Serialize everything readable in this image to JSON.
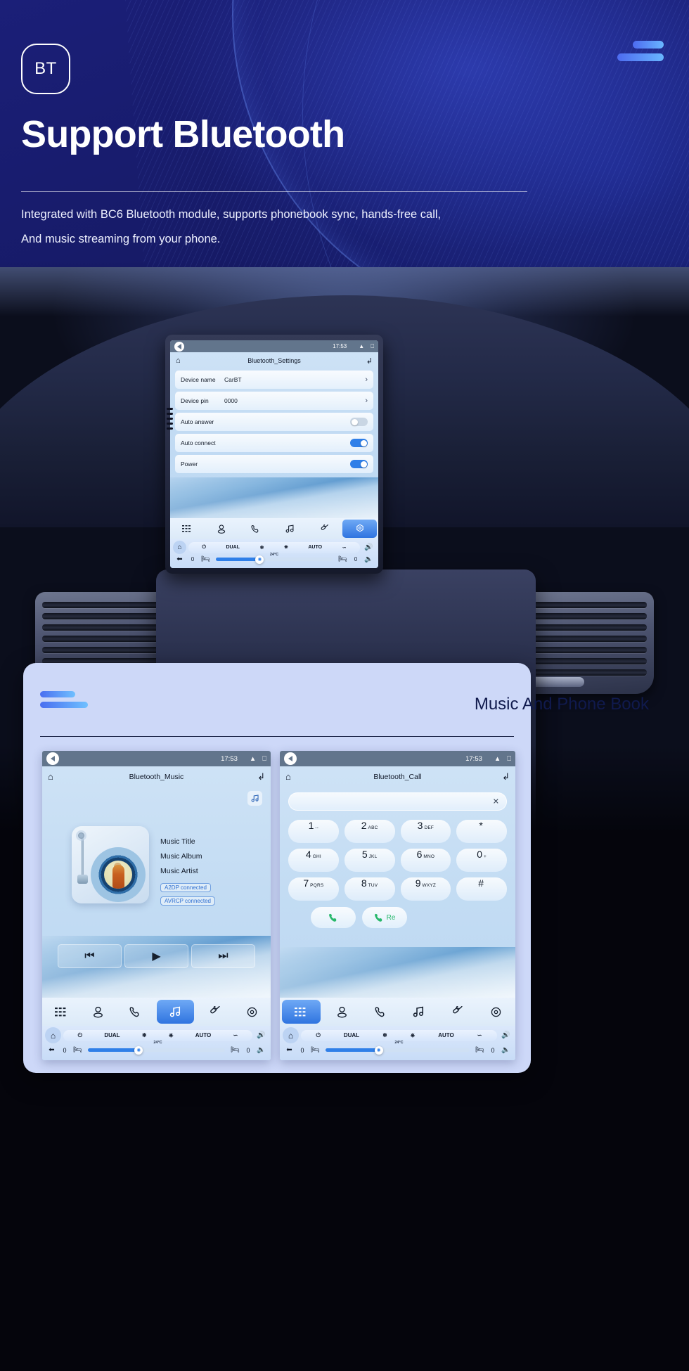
{
  "hero": {
    "badge": "BT",
    "title": "Support Bluetooth",
    "subtitle_line1": "Integrated with BC6 Bluetooth module, supports phonebook sync, hands-free call,",
    "subtitle_line2": "And music streaming from your phone.",
    "accent_start": "#4d6bf0",
    "accent_end": "#69b6ff",
    "bg_color": "#181c6e"
  },
  "settings_screen": {
    "status": {
      "time": "17:53",
      "speaker_icon": "speaker-icon",
      "chevron_icon": "chevrons-up-icon",
      "recent_icon": "recents-icon"
    },
    "home_icon": "home-icon",
    "title": "Bluetooth_Settings",
    "back_icon": "back-arrow-icon",
    "rows": [
      {
        "label": "Device name",
        "value": "CarBT",
        "control": "chevron",
        "chevron": "›"
      },
      {
        "label": "Device pin",
        "value": "0000",
        "control": "chevron",
        "chevron": "›"
      },
      {
        "label": "Auto answer",
        "value": "",
        "control": "toggle",
        "on": false
      },
      {
        "label": "Auto connect",
        "value": "",
        "control": "toggle",
        "on": true
      },
      {
        "label": "Power",
        "value": "",
        "control": "toggle",
        "on": true
      }
    ],
    "dock": [
      {
        "icon": "apps-grid-icon",
        "active": false
      },
      {
        "icon": "contact-person-icon",
        "active": false
      },
      {
        "icon": "phone-handset-icon",
        "active": false
      },
      {
        "icon": "music-note-icon",
        "active": false
      },
      {
        "icon": "link-chain-icon",
        "active": false
      },
      {
        "icon": "settings-gear-icon",
        "active": true
      }
    ],
    "climate": {
      "home_icon": "home-icon",
      "power_icon": "power-icon",
      "dual_label": "DUAL",
      "snowflake_icon": "snowflake-icon",
      "defrost_rear_icon": "rear-defrost-icon",
      "auto_label": "AUTO",
      "recirculate_icon": "recirculate-icon",
      "vol_up_icon": "volume-up-icon",
      "vol_down_icon": "volume-down-icon",
      "back_icon": "back-arrow-icon",
      "left_temp": "0",
      "right_temp": "0",
      "temperature": "24°C",
      "seat_icon": "seat-icon",
      "seat_heat_icon": "seat-heat-icon",
      "fan_icon": "fan-icon"
    }
  },
  "card": {
    "title": "Music And Phone Book",
    "accent_start": "#4a6ef0",
    "accent_end": "#6fc0ff",
    "bg": "#cdd8f8"
  },
  "music_screen": {
    "status": {
      "time": "17:53",
      "speaker_icon": "speaker-icon",
      "chevron_icon": "chevrons-up-icon",
      "recent_icon": "recents-icon"
    },
    "home_icon": "home-icon",
    "title": "Bluetooth_Music",
    "back_icon": "back-arrow-icon",
    "note_button_icon": "music-note-icon",
    "album_art_icon": "turntable-vinyl-icon",
    "track": {
      "title": "Music Title",
      "album": "Music Album",
      "artist": "Music Artist"
    },
    "badges": [
      "A2DP  connected",
      "AVRCP connected"
    ],
    "controls": [
      {
        "icon": "previous-track-icon",
        "glyph": "⏮"
      },
      {
        "icon": "play-icon",
        "glyph": "▶"
      },
      {
        "icon": "next-track-icon",
        "glyph": "⏭"
      }
    ],
    "dock": [
      {
        "icon": "apps-grid-icon",
        "active": false
      },
      {
        "icon": "contact-person-icon",
        "active": false
      },
      {
        "icon": "phone-handset-icon",
        "active": false
      },
      {
        "icon": "music-note-icon",
        "active": true
      },
      {
        "icon": "link-chain-icon",
        "active": false
      },
      {
        "icon": "settings-gear-icon",
        "active": false
      }
    ],
    "climate": {
      "dual_label": "DUAL",
      "auto_label": "AUTO",
      "left_temp": "0",
      "right_temp": "0",
      "temperature": "24°C"
    }
  },
  "call_screen": {
    "status": {
      "time": "17:53",
      "speaker_icon": "speaker-icon",
      "chevron_icon": "chevrons-up-icon",
      "recent_icon": "recents-icon"
    },
    "home_icon": "home-icon",
    "title": "Bluetooth_Call",
    "back_icon": "back-arrow-icon",
    "number_input_value": "",
    "clear_icon": "close-x-icon",
    "keypad": [
      {
        "n": "1",
        "s": "--"
      },
      {
        "n": "2",
        "s": "ABC"
      },
      {
        "n": "3",
        "s": "DEF"
      },
      {
        "n": "*",
        "s": ""
      },
      {
        "n": "4",
        "s": "GHI"
      },
      {
        "n": "5",
        "s": "JKL"
      },
      {
        "n": "6",
        "s": "MNO"
      },
      {
        "n": "0",
        "s": "+"
      },
      {
        "n": "7",
        "s": "PQRS"
      },
      {
        "n": "8",
        "s": "TUV"
      },
      {
        "n": "9",
        "s": "WXYZ"
      },
      {
        "n": "#",
        "s": ""
      }
    ],
    "dial_button_icon": "phone-call-icon",
    "redial_button_label": "Re",
    "redial_button_icon": "phone-redial-icon",
    "dock": [
      {
        "icon": "apps-grid-icon",
        "active": true
      },
      {
        "icon": "contact-person-icon",
        "active": false
      },
      {
        "icon": "phone-handset-icon",
        "active": false
      },
      {
        "icon": "music-note-icon",
        "active": false
      },
      {
        "icon": "link-chain-icon",
        "active": false
      },
      {
        "icon": "settings-gear-icon",
        "active": false
      }
    ],
    "climate": {
      "dual_label": "DUAL",
      "auto_label": "AUTO",
      "left_temp": "0",
      "right_temp": "0",
      "temperature": "24°C"
    }
  }
}
